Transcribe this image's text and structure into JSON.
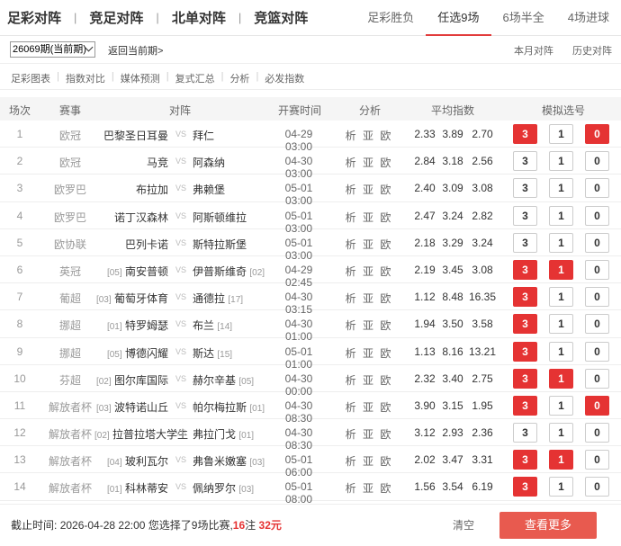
{
  "nav": {
    "main_tabs": [
      "足彩对阵",
      "竞足对阵",
      "北单对阵",
      "竞篮对阵"
    ],
    "separator": "|",
    "sub_tabs": [
      "足彩胜负",
      "任选9场",
      "6场半全",
      "4场进球"
    ],
    "active_sub_tab": "任选9场"
  },
  "period": {
    "selected": "26069期(当前期)",
    "return_link": "返回当前期>",
    "right_links": [
      "本月对阵",
      "历史对阵"
    ]
  },
  "tools": [
    "足彩图表",
    "指数对比",
    "媒体预测",
    "复式汇总",
    "分析",
    "必发指数"
  ],
  "table": {
    "headers": {
      "num": "场次",
      "league": "赛事",
      "match": "对阵",
      "time": "开赛时间",
      "analysis": "分析",
      "odds": "平均指数",
      "picks": "模拟选号"
    },
    "vs_text": "VS",
    "analysis_text": "析 亚 欧",
    "pick_labels": [
      "3",
      "1",
      "0"
    ],
    "rows": [
      {
        "num": "1",
        "league": "欧冠",
        "home_rank": "",
        "home": "巴黎圣日耳曼",
        "away": "拜仁",
        "away_rank": "",
        "time": "04-29 03:00",
        "odds": [
          "2.33",
          "3.89",
          "2.70"
        ],
        "picks": [
          true,
          false,
          true
        ]
      },
      {
        "num": "2",
        "league": "欧冠",
        "home_rank": "",
        "home": "马竞",
        "away": "阿森纳",
        "away_rank": "",
        "time": "04-30 03:00",
        "odds": [
          "2.84",
          "3.18",
          "2.56"
        ],
        "picks": [
          false,
          false,
          false
        ]
      },
      {
        "num": "3",
        "league": "欧罗巴",
        "home_rank": "",
        "home": "布拉加",
        "away": "弗赖堡",
        "away_rank": "",
        "time": "05-01 03:00",
        "odds": [
          "2.40",
          "3.09",
          "3.08"
        ],
        "picks": [
          false,
          false,
          false
        ]
      },
      {
        "num": "4",
        "league": "欧罗巴",
        "home_rank": "",
        "home": "诺丁汉森林",
        "away": "阿斯顿维拉",
        "away_rank": "",
        "time": "05-01 03:00",
        "odds": [
          "2.47",
          "3.24",
          "2.82"
        ],
        "picks": [
          false,
          false,
          false
        ]
      },
      {
        "num": "5",
        "league": "欧协联",
        "home_rank": "",
        "home": "巴列卡诺",
        "away": "斯特拉斯堡",
        "away_rank": "",
        "time": "05-01 03:00",
        "odds": [
          "2.18",
          "3.29",
          "3.24"
        ],
        "picks": [
          false,
          false,
          false
        ]
      },
      {
        "num": "6",
        "league": "英冠",
        "home_rank": "[05]",
        "home": "南安普顿",
        "away": "伊普斯维奇",
        "away_rank": "[02]",
        "time": "04-29 02:45",
        "odds": [
          "2.19",
          "3.45",
          "3.08"
        ],
        "picks": [
          true,
          true,
          false
        ]
      },
      {
        "num": "7",
        "league": "葡超",
        "home_rank": "[03]",
        "home": "葡萄牙体育",
        "away": "通德拉",
        "away_rank": "[17]",
        "time": "04-30 03:15",
        "odds": [
          "1.12",
          "8.48",
          "16.35"
        ],
        "picks": [
          true,
          false,
          false
        ]
      },
      {
        "num": "8",
        "league": "挪超",
        "home_rank": "[01]",
        "home": "特罗姆瑟",
        "away": "布兰",
        "away_rank": "[14]",
        "time": "04-30 01:00",
        "odds": [
          "1.94",
          "3.50",
          "3.58"
        ],
        "picks": [
          true,
          false,
          false
        ]
      },
      {
        "num": "9",
        "league": "挪超",
        "home_rank": "[05]",
        "home": "博德闪耀",
        "away": "斯达",
        "away_rank": "[15]",
        "time": "05-01 01:00",
        "odds": [
          "1.13",
          "8.16",
          "13.21"
        ],
        "picks": [
          true,
          false,
          false
        ]
      },
      {
        "num": "10",
        "league": "芬超",
        "home_rank": "[02]",
        "home": "图尔库国际",
        "away": "赫尔辛基",
        "away_rank": "[05]",
        "time": "04-30 00:00",
        "odds": [
          "2.32",
          "3.40",
          "2.75"
        ],
        "picks": [
          true,
          true,
          false
        ]
      },
      {
        "num": "11",
        "league": "解放者杯",
        "home_rank": "[03]",
        "home": "波特诺山丘",
        "away": "帕尔梅拉斯",
        "away_rank": "[01]",
        "time": "04-30 08:30",
        "odds": [
          "3.90",
          "3.15",
          "1.95"
        ],
        "picks": [
          true,
          false,
          true
        ]
      },
      {
        "num": "12",
        "league": "解放者杯",
        "home_rank": "[02]",
        "home": "拉普拉塔大学生",
        "away": "弗拉门戈",
        "away_rank": "[01]",
        "time": "04-30 08:30",
        "odds": [
          "3.12",
          "2.93",
          "2.36"
        ],
        "picks": [
          false,
          false,
          false
        ]
      },
      {
        "num": "13",
        "league": "解放者杯",
        "home_rank": "[04]",
        "home": "玻利瓦尔",
        "away": "弗鲁米嫩塞",
        "away_rank": "[03]",
        "time": "05-01 06:00",
        "odds": [
          "2.02",
          "3.47",
          "3.31"
        ],
        "picks": [
          true,
          true,
          false
        ]
      },
      {
        "num": "14",
        "league": "解放者杯",
        "home_rank": "[01]",
        "home": "科林蒂安",
        "away": "佩纳罗尔",
        "away_rank": "[03]",
        "time": "05-01 08:00",
        "odds": [
          "1.56",
          "3.54",
          "6.19"
        ],
        "picks": [
          true,
          false,
          false
        ]
      }
    ]
  },
  "footer": {
    "deadline_label": "截止时间:",
    "deadline": "2026-04-28 22:00",
    "selected_text_a": "您选择了9场比赛,",
    "bets": "16",
    "bets_unit": "注",
    "amount": "32元",
    "clear": "清空",
    "more": "查看更多"
  },
  "colors": {
    "accent_red": "#e53333",
    "button_red": "#e85a4f"
  }
}
